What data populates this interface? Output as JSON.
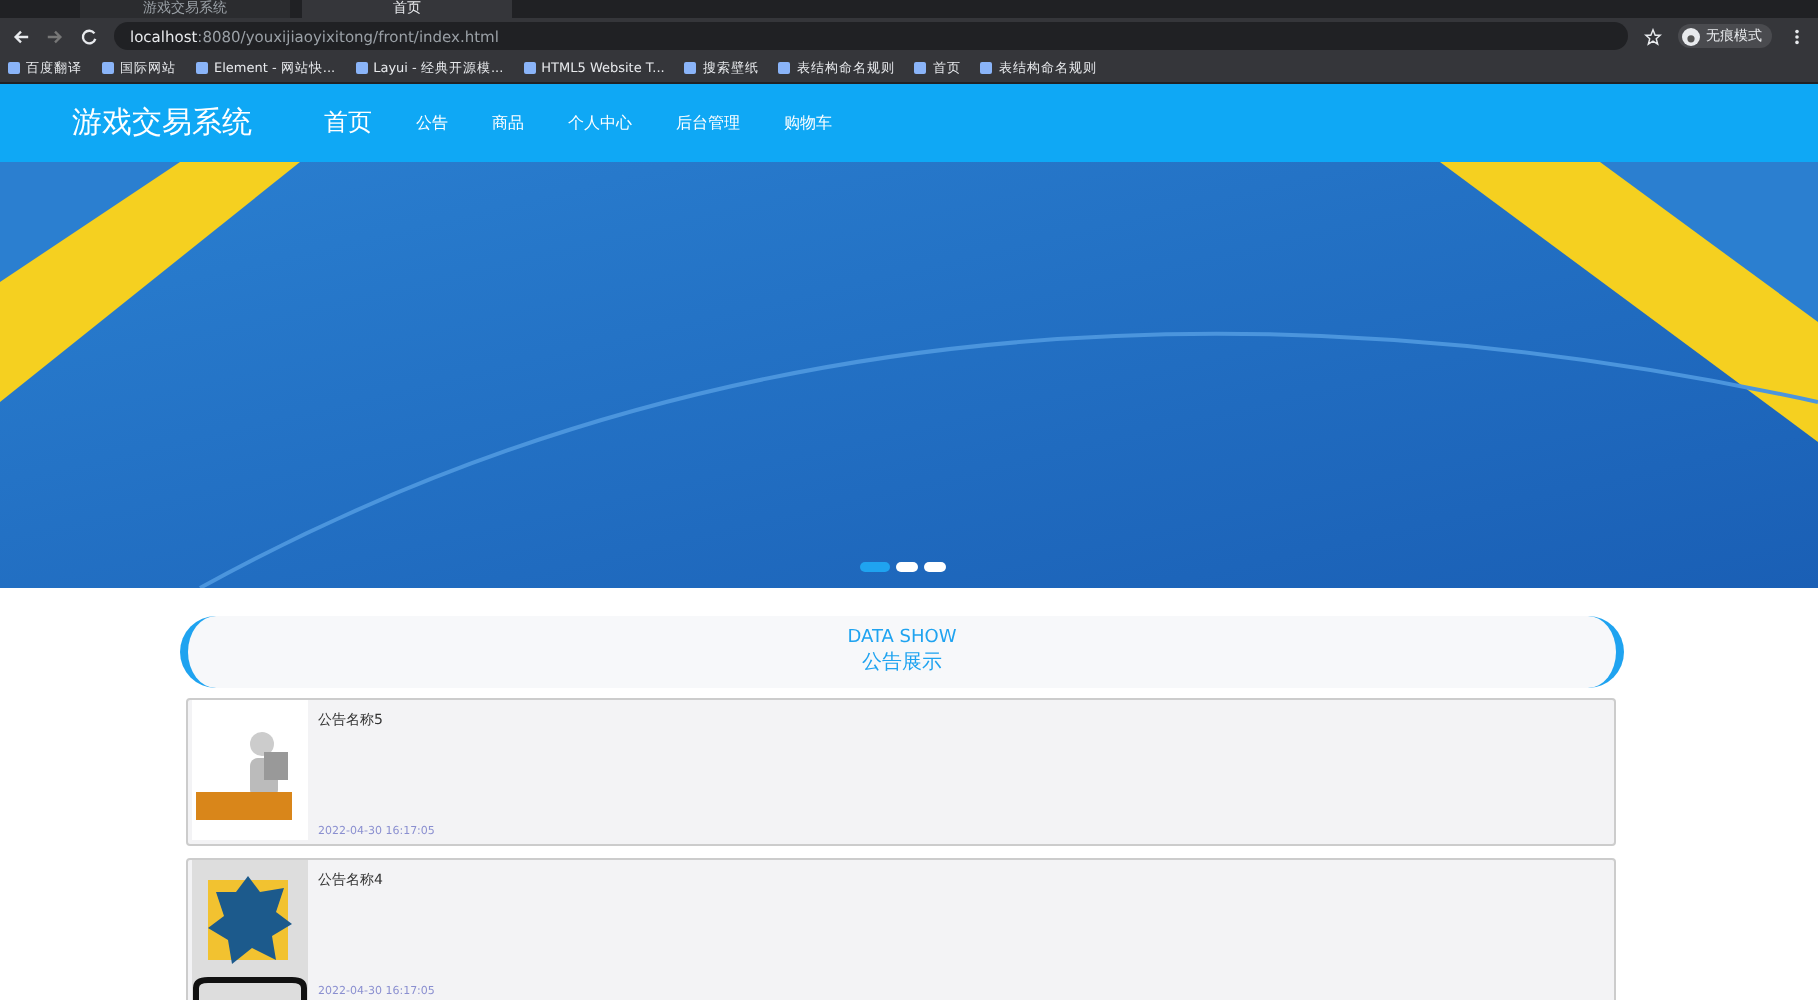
{
  "browser": {
    "tabs": [
      {
        "title": "游戏交易系统",
        "selected": false
      },
      {
        "title": "首页",
        "selected": true
      }
    ],
    "address": {
      "host": "localhost",
      "path": ":8080/youxijiaoyixitong/front/index.html"
    },
    "profile": "无痕模式",
    "bookmarks": [
      "百度翻译",
      "国际网站",
      "Element - 网站快...",
      "Layui - 经典开源模...",
      "HTML5 Website T...",
      "搜索壁纸",
      "表结构命名规则",
      "首页",
      "表结构命名规则"
    ]
  },
  "nav": {
    "brand": "游戏交易系统",
    "items": [
      {
        "label": "首页",
        "selected": true
      },
      {
        "label": "公告",
        "selected": false
      },
      {
        "label": "商品",
        "selected": false
      },
      {
        "label": "个人中心",
        "selected": false
      },
      {
        "label": "后台管理",
        "selected": false
      },
      {
        "label": "购物车",
        "selected": false
      }
    ]
  },
  "carousel": {
    "dots": [
      {
        "selected": true
      },
      {
        "selected": false
      },
      {
        "selected": false
      }
    ]
  },
  "section": {
    "title_en": "DATA SHOW",
    "title": "公告展示"
  },
  "notices": [
    {
      "title": "公告名称5",
      "time": "2022-04-30 16:17:05",
      "kind": "news"
    },
    {
      "title": "公告名称4",
      "time": "2022-04-30 16:17:05",
      "kind": "badge"
    }
  ]
}
